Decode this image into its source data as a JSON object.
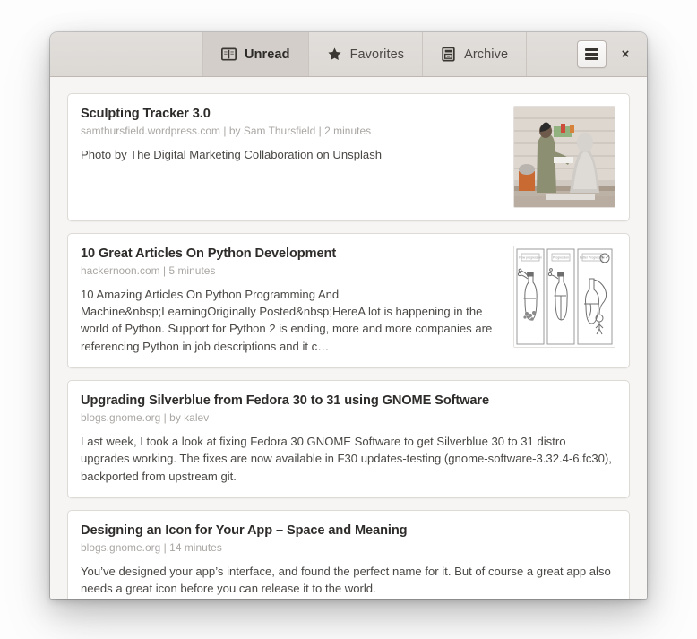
{
  "window": {
    "headerbar": {
      "tabs": [
        {
          "label": "Unread",
          "icon": "book-open-icon",
          "active": true
        },
        {
          "label": "Favorites",
          "icon": "star-icon",
          "active": false
        },
        {
          "label": "Archive",
          "icon": "archive-box-icon",
          "active": false
        }
      ],
      "menu_button": {
        "icon": "hamburger-menu-icon",
        "label": ""
      },
      "close_button": {
        "icon": "close-icon",
        "label": "×"
      }
    }
  },
  "articles": [
    {
      "title": "Sculpting Tracker 3.0",
      "meta": "samthursfield.wordpress.com | by Sam Thursfield  | 2 minutes",
      "summary": "Photo by The Digital Marketing Collaboration on Unsplash",
      "thumbnail": "sculptor-photo-thumbnail"
    },
    {
      "title": "10 Great Articles On Python Development",
      "meta": "hackernoon.com | 5 minutes",
      "summary": "10 Amazing Articles On Python Programming And Machine&nbsp;LearningOriginally Posted&nbsp;HereA lot is happening in the world of Python. Support for Python 2 is ending, more and more companies are referencing Python in job descriptions and it c…",
      "thumbnail": "three-panel-bottle-diagram-thumbnail"
    },
    {
      "title": "Upgrading Silverblue from Fedora 30 to 31 using GNOME Software",
      "meta": "blogs.gnome.org | by kalev",
      "summary": "Last week, I took a look at fixing Fedora 30 GNOME Software to get Silverblue 30 to 31 distro upgrades working. The fixes are now available in F30 updates-testing (gnome-software-3.32.4-6.fc30), backported from upstream git.",
      "thumbnail": null
    },
    {
      "title": "Designing an Icon for Your App – Space and Meaning",
      "meta": "blogs.gnome.org | 14 minutes",
      "summary": "You’ve designed your app’s interface, and found the perfect name for it. But of course a great app also needs a great icon before you can release it to the world.",
      "thumbnail": null
    }
  ],
  "colors": {
    "headerbar_bg": "#ddd9d5",
    "active_tab_bg": "#d3cec9",
    "content_bg": "#f6f5f4",
    "card_bg": "#ffffff",
    "card_border": "#dedad6",
    "title_text": "#2e2c2a",
    "meta_text": "#a9a6a3",
    "summary_text": "#4a4845"
  }
}
